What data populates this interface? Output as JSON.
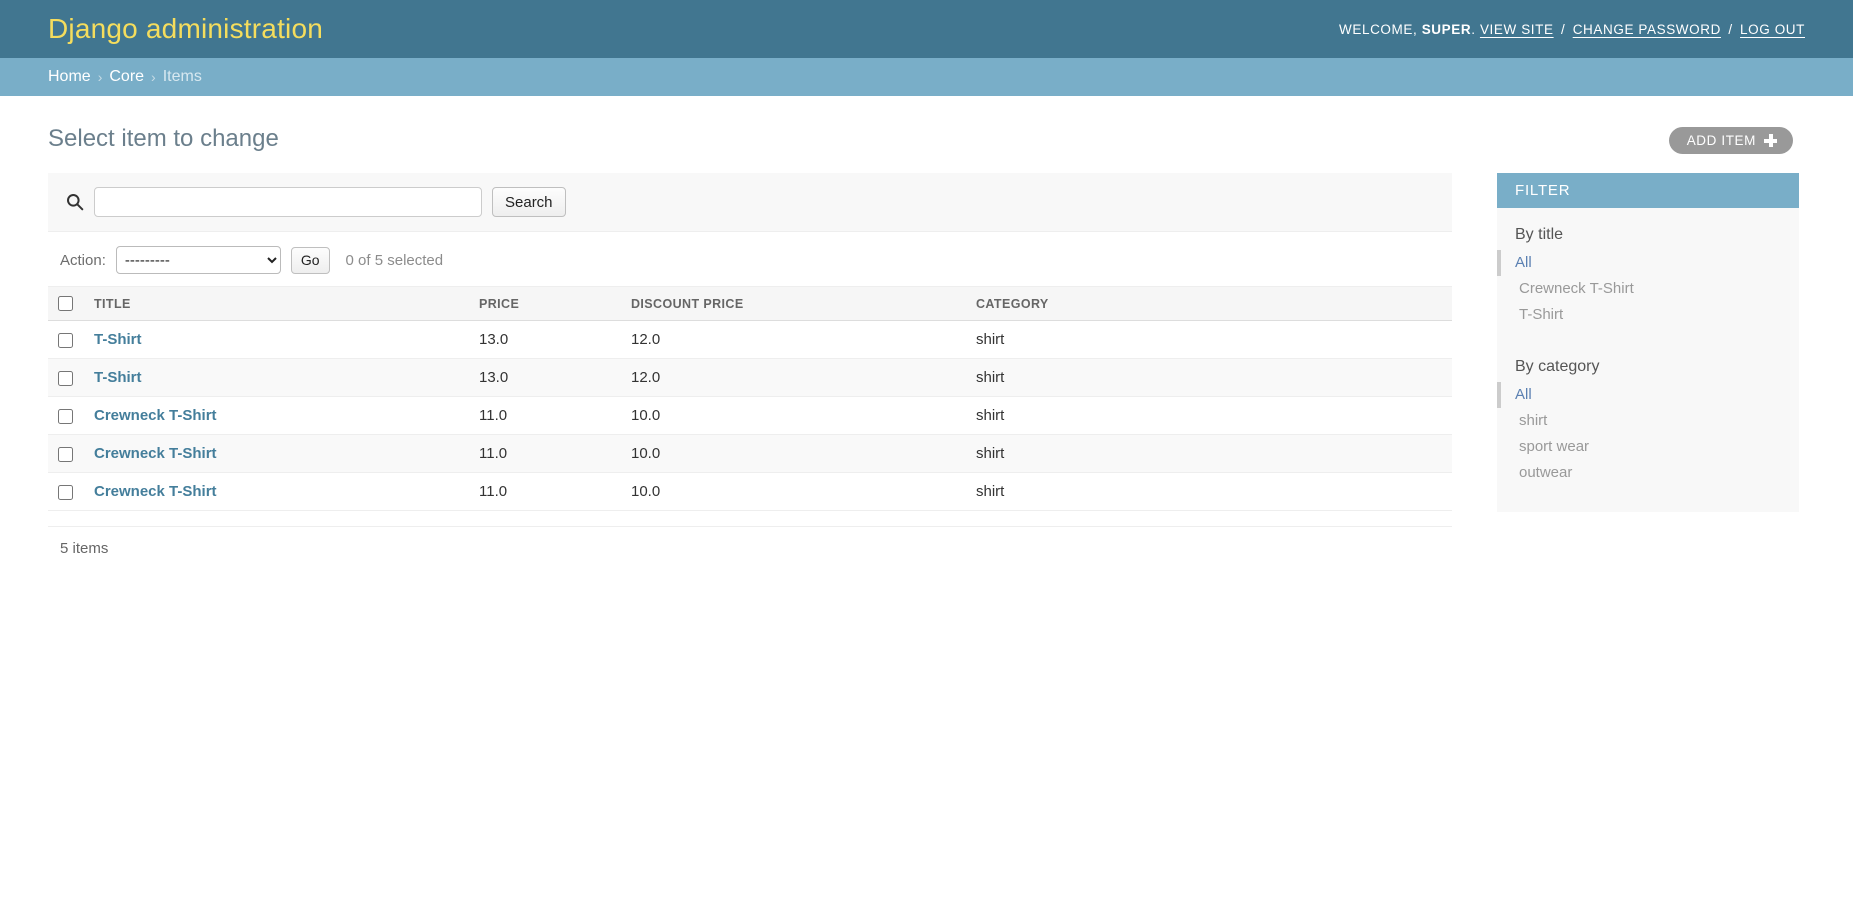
{
  "header": {
    "site_title": "Django administration",
    "welcome_prefix": "WELCOME,",
    "username": "SUPER",
    "welcome_suffix": ".",
    "view_site_label": "VIEW SITE",
    "change_password_label": "CHANGE PASSWORD",
    "log_out_label": "LOG OUT",
    "separator": "/"
  },
  "breadcrumbs": {
    "home": "Home",
    "app": "Core",
    "model": "Items",
    "separator": "›"
  },
  "content": {
    "page_title": "Select item to change",
    "add_button_label": "ADD ITEM",
    "add_button_icon": "plus-icon"
  },
  "search": {
    "placeholder": "",
    "value": "",
    "submit_label": "Search",
    "icon": "search-icon"
  },
  "actions": {
    "label": "Action:",
    "selected_option": "---------",
    "options": [
      "---------"
    ],
    "go_label": "Go",
    "counter": "0 of 5 selected"
  },
  "table": {
    "columns": [
      "TITLE",
      "PRICE",
      "DISCOUNT PRICE",
      "CATEGORY"
    ],
    "rows": [
      {
        "title": "T-Shirt",
        "price": "13.0",
        "discount_price": "12.0",
        "category": "shirt",
        "checked": false
      },
      {
        "title": "T-Shirt",
        "price": "13.0",
        "discount_price": "12.0",
        "category": "shirt",
        "checked": false
      },
      {
        "title": "Crewneck T-Shirt",
        "price": "11.0",
        "discount_price": "10.0",
        "category": "shirt",
        "checked": false
      },
      {
        "title": "Crewneck T-Shirt",
        "price": "11.0",
        "discount_price": "10.0",
        "category": "shirt",
        "checked": false
      },
      {
        "title": "Crewneck T-Shirt",
        "price": "11.0",
        "discount_price": "10.0",
        "category": "shirt",
        "checked": false
      }
    ]
  },
  "paginator": {
    "count_label": "5 items"
  },
  "filter": {
    "title": "FILTER",
    "groups": [
      {
        "heading": "By title",
        "choices": [
          {
            "label": "All",
            "selected": true
          },
          {
            "label": "Crewneck T-Shirt",
            "selected": false
          },
          {
            "label": "T-Shirt",
            "selected": false
          }
        ]
      },
      {
        "heading": "By category",
        "choices": [
          {
            "label": "All",
            "selected": true
          },
          {
            "label": "shirt",
            "selected": false
          },
          {
            "label": "sport wear",
            "selected": false
          },
          {
            "label": "outwear",
            "selected": false
          }
        ]
      }
    ]
  },
  "colors": {
    "header_bg": "#417690",
    "header_accent": "#f5dd5d",
    "breadcrumb_bg": "#79aec8",
    "link": "#447e9b",
    "filter_header_bg": "#79aec8",
    "add_button_bg": "#999999"
  }
}
